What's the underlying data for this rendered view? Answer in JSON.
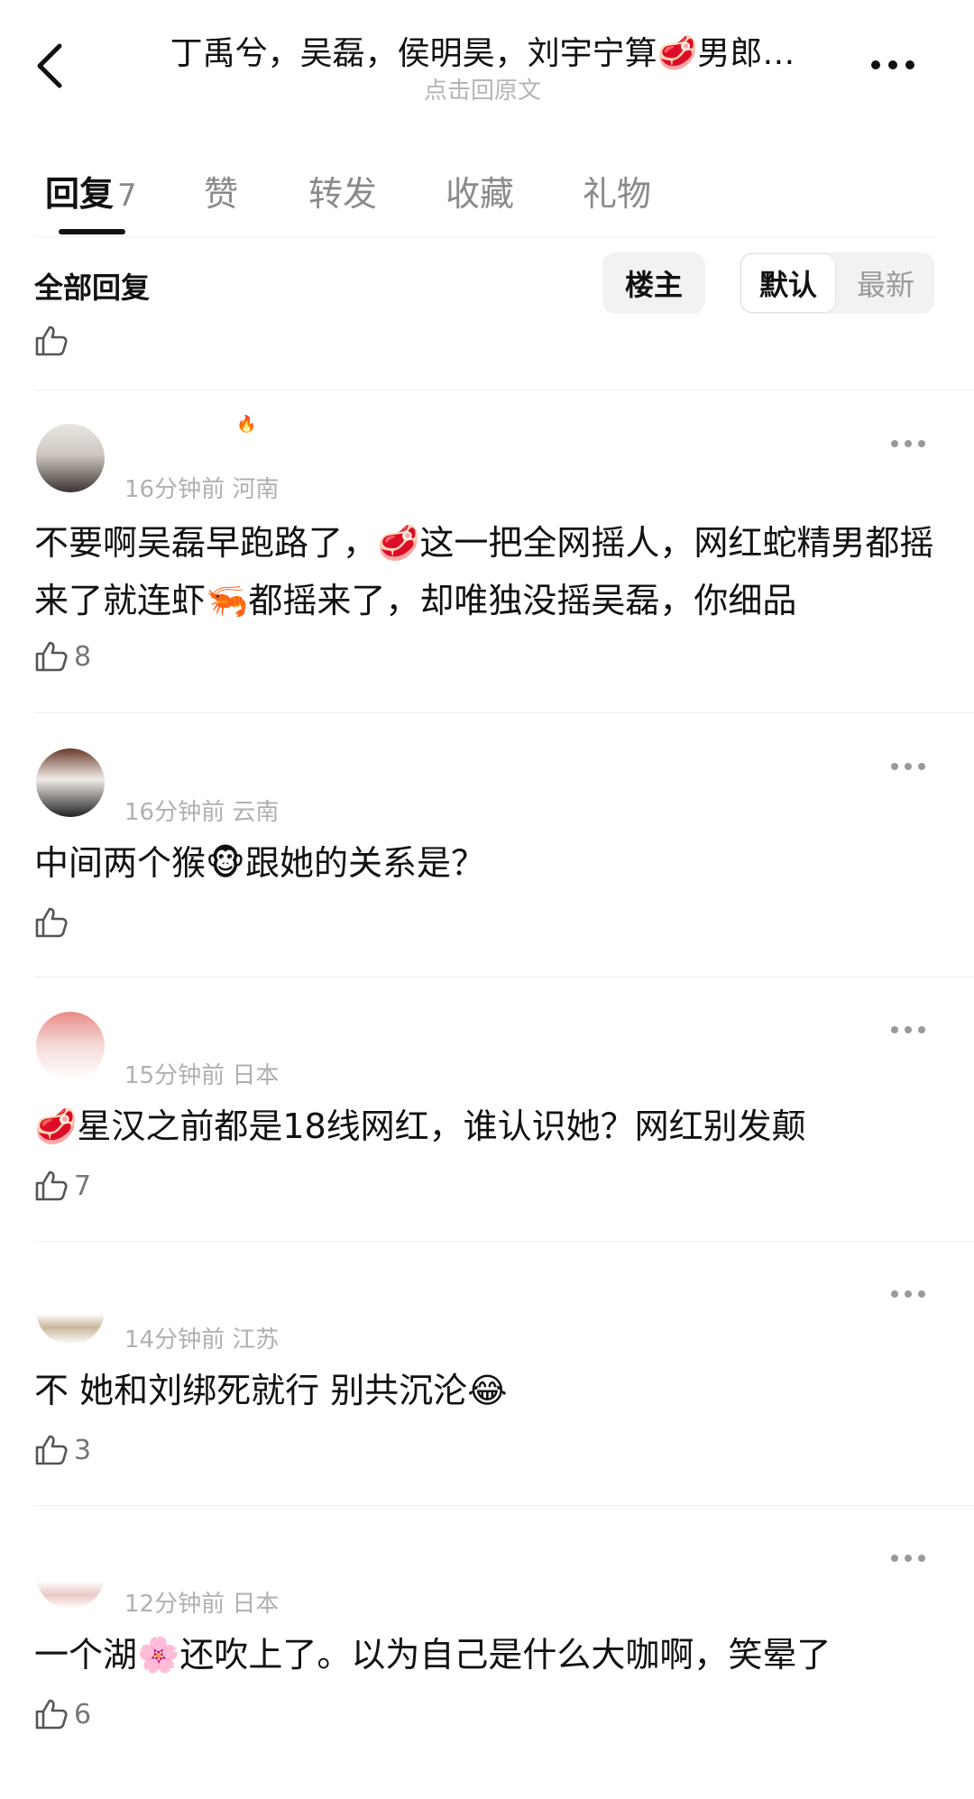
{
  "header": {
    "title": "丁禹兮，吴磊，侯明昊，刘宇宁算🥩男郎…",
    "subtitle": "点击回原文"
  },
  "tabs": [
    {
      "label": "回复",
      "count": "7"
    },
    {
      "label": "赞"
    },
    {
      "label": "转发"
    },
    {
      "label": "收藏"
    },
    {
      "label": "礼物"
    }
  ],
  "filter": {
    "title": "全部回复",
    "owner_label": "楼主",
    "sort_default": "默认",
    "sort_latest": "最新"
  },
  "comments": [
    {
      "meta": "16分钟前 河南",
      "text": "不要啊吴磊早跑路了，🥩这一把全网摇人，网红蛇精男都摇来了就连虾🦐都摇来了，却唯独没摇吴磊，你细品",
      "likes": "8"
    },
    {
      "meta": "16分钟前 云南",
      "text": "中间两个猴🐵跟她的关系是？",
      "likes": ""
    },
    {
      "meta": "15分钟前 日本",
      "text": "🥩星汉之前都是18线网红，谁认识她？网红别发颠",
      "likes": "7"
    },
    {
      "meta": "14分钟前 江苏",
      "text": "不 她和刘绑死就行 别共沉沦😂",
      "likes": "3"
    },
    {
      "meta": "12分钟前 日本",
      "text": "一个湖🌸还吹上了。以为自己是什么大咖啊，笑晕了",
      "likes": "6"
    }
  ]
}
